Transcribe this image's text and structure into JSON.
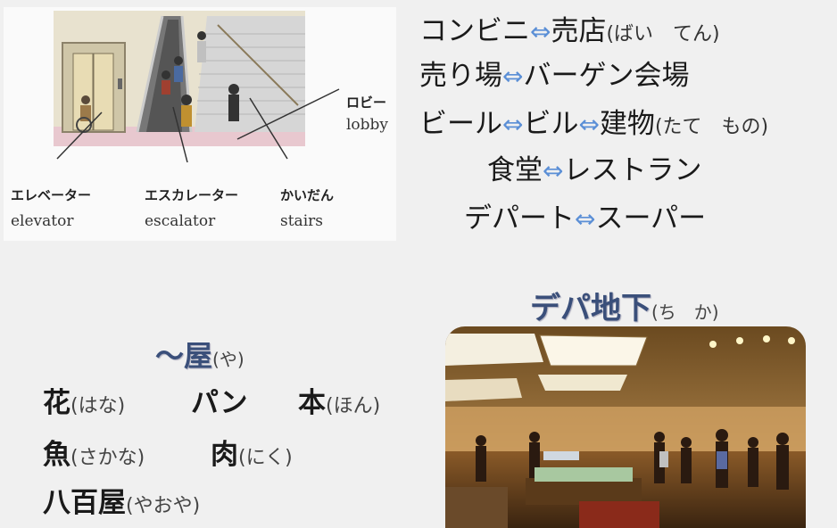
{
  "illustration": {
    "lobby_jp": "ロビー",
    "lobby_en": "lobby",
    "elevator_jp": "エレベーター",
    "elevator_en": "elevator",
    "escalator_jp": "エスカレーター",
    "escalator_en": "escalator",
    "stairs_jp": "かいだん",
    "stairs_en": "stairs"
  },
  "vocab": {
    "line1": {
      "a": "コンビニ",
      "arrow": "⇔",
      "b": "売店",
      "reading": "(ばい　てん)"
    },
    "line2": {
      "a": "売り場",
      "arrow": "⇔",
      "b": "バーゲン会場"
    },
    "line3": {
      "a": "ビール",
      "arrow1": "⇔",
      "b": "ビル",
      "arrow2": "⇔",
      "c": "建物",
      "reading": "(たて　もの)"
    },
    "line4": {
      "a": "食堂",
      "arrow": "⇔",
      "b": "レストラン"
    },
    "line5": {
      "a": "デパート",
      "arrow": "⇔",
      "b": "スーパー"
    }
  },
  "shops": {
    "header": "～屋",
    "header_reading": "(や)",
    "items": [
      {
        "word": "花",
        "reading": "(はな)"
      },
      {
        "word": "パン",
        "reading": ""
      },
      {
        "word": "本",
        "reading": "(ほん)"
      },
      {
        "word": "魚",
        "reading": "(さかな)"
      },
      {
        "word": "肉",
        "reading": "(にく)"
      },
      {
        "word": "八百屋",
        "reading": "(やおや)"
      }
    ]
  },
  "depachika": {
    "title": "デパ地下",
    "reading": "(ち　か)"
  }
}
